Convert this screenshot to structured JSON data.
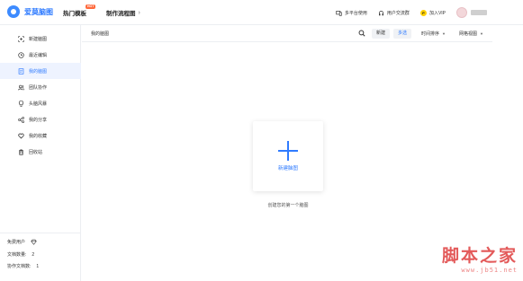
{
  "header": {
    "logo_text": "爱莫脑图",
    "nav": [
      {
        "label": "热门模板",
        "badge": "HOT"
      },
      {
        "label": "制作流程图"
      }
    ],
    "right": [
      {
        "label": "多平台使用",
        "icon": "devices-icon"
      },
      {
        "label": "用户交流群",
        "icon": "headset-icon"
      },
      {
        "label": "加入VIP",
        "icon": "vip-icon"
      }
    ]
  },
  "sidebar": {
    "items": [
      {
        "label": "新建脑图",
        "icon": "new-map-icon"
      },
      {
        "label": "最近编辑",
        "icon": "clock-icon"
      },
      {
        "label": "我的脑图",
        "icon": "document-icon",
        "active": true
      },
      {
        "label": "团队协作",
        "icon": "team-icon"
      },
      {
        "label": "头脑风暴",
        "icon": "lightbulb-icon"
      },
      {
        "label": "我的分享",
        "icon": "share-icon"
      },
      {
        "label": "我的收藏",
        "icon": "heart-icon"
      },
      {
        "label": "回收站",
        "icon": "trash-icon"
      }
    ],
    "footer": {
      "user_type": "免费用户",
      "doc_count_label": "文档数量:",
      "doc_count": "2",
      "collab_count_label": "协作文档数:",
      "collab_count": "1"
    }
  },
  "toolbar": {
    "breadcrumb": "我的脑图",
    "new_label": "新建",
    "multi_select_label": "多选",
    "sort_label": "时间排序",
    "view_label": "网格视图"
  },
  "main": {
    "new_card_label": "新建脑图",
    "empty_hint": "创建您的第一个脑图"
  },
  "watermark": {
    "text": "脚本之家",
    "url": "www.jb51.net"
  },
  "colors": {
    "accent": "#2f7bff",
    "active_bg": "#eef3ff"
  }
}
